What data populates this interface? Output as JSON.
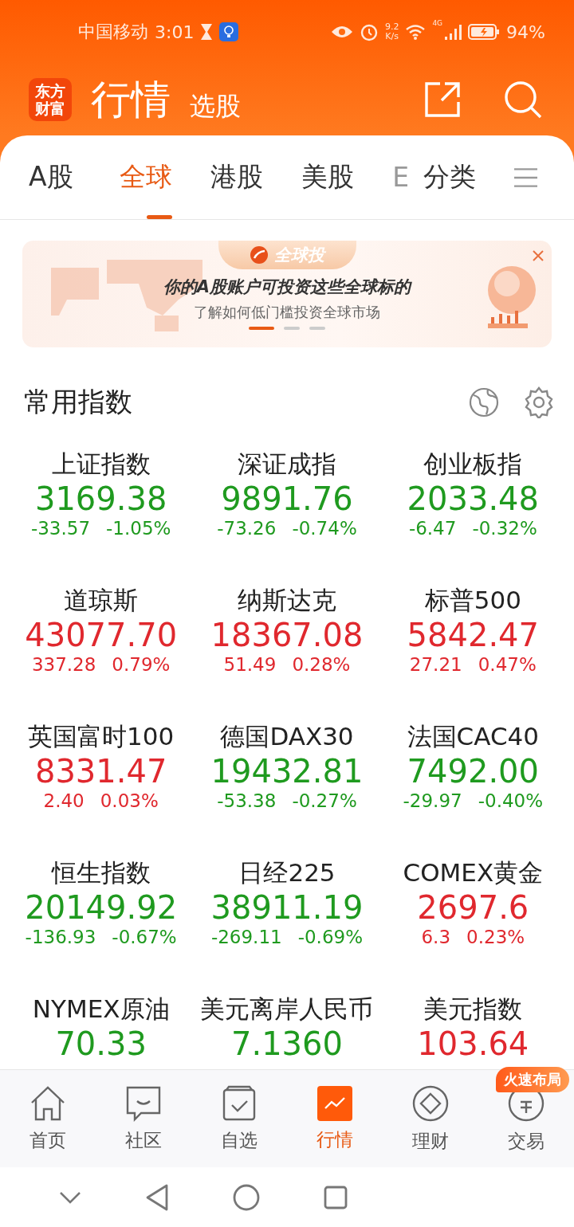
{
  "status_bar": {
    "carrier": "中国移动",
    "time": "3:01",
    "speed_value": "9.2",
    "speed_unit": "K/s",
    "network": "4G",
    "battery": "94%"
  },
  "header": {
    "logo": "东方财富",
    "title": "行情",
    "subtitle": "选股"
  },
  "tabs": [
    {
      "label": "A股",
      "selected": false
    },
    {
      "label": "全球",
      "selected": true
    },
    {
      "label": "港股",
      "selected": false
    },
    {
      "label": "美股",
      "selected": false
    },
    {
      "label": "E",
      "selected": false
    },
    {
      "label": "分类",
      "selected": false
    }
  ],
  "banner": {
    "ribbon": "全球投",
    "title": "你的A股账户可投资这些全球标的",
    "subtitle": "了解如何低门槛投资全球市场",
    "dots": [
      {
        "selected": true
      },
      {
        "selected": false
      },
      {
        "selected": false
      }
    ]
  },
  "section": {
    "title": "常用指数"
  },
  "indices": [
    {
      "name": "上证指数",
      "value": "3169.38",
      "change": "-33.57",
      "pct": "-1.05%",
      "color": "#1f9a1f"
    },
    {
      "name": "深证成指",
      "value": "9891.76",
      "change": "-73.26",
      "pct": "-0.74%",
      "color": "#1f9a1f"
    },
    {
      "name": "创业板指",
      "value": "2033.48",
      "change": "-6.47",
      "pct": "-0.32%",
      "color": "#1f9a1f"
    },
    {
      "name": "道琼斯",
      "value": "43077.70",
      "change": "337.28",
      "pct": "0.79%",
      "color": "#e0282e"
    },
    {
      "name": "纳斯达克",
      "value": "18367.08",
      "change": "51.49",
      "pct": "0.28%",
      "color": "#e0282e"
    },
    {
      "name": "标普500",
      "value": "5842.47",
      "change": "27.21",
      "pct": "0.47%",
      "color": "#e0282e"
    },
    {
      "name": "英国富时100",
      "value": "8331.47",
      "change": "2.40",
      "pct": "0.03%",
      "color": "#e0282e"
    },
    {
      "name": "德国DAX30",
      "value": "19432.81",
      "change": "-53.38",
      "pct": "-0.27%",
      "color": "#1f9a1f"
    },
    {
      "name": "法国CAC40",
      "value": "7492.00",
      "change": "-29.97",
      "pct": "-0.40%",
      "color": "#1f9a1f"
    },
    {
      "name": "恒生指数",
      "value": "20149.92",
      "change": "-136.93",
      "pct": "-0.67%",
      "color": "#1f9a1f"
    },
    {
      "name": "日经225",
      "value": "38911.19",
      "change": "-269.11",
      "pct": "-0.69%",
      "color": "#1f9a1f"
    },
    {
      "name": "COMEX黄金",
      "value": "2697.6",
      "change": "6.3",
      "pct": "0.23%",
      "color": "#e0282e"
    },
    {
      "name": "NYMEX原油",
      "value": "70.33",
      "color": "#1f9a1f"
    },
    {
      "name": "美元离岸人民币",
      "value": "7.1360",
      "color": "#1f9a1f"
    },
    {
      "name": "美元指数",
      "value": "103.64",
      "color": "#e0282e"
    }
  ],
  "bottom_nav": [
    {
      "label": "首页",
      "kind": "home",
      "selected": false
    },
    {
      "label": "社区",
      "kind": "chat",
      "selected": false
    },
    {
      "label": "自选",
      "kind": "check",
      "selected": false
    },
    {
      "label": "行情",
      "kind": "chart",
      "selected": true
    },
    {
      "label": "理财",
      "kind": "diamond",
      "selected": false
    },
    {
      "label": "交易",
      "kind": "yen",
      "selected": false
    }
  ],
  "promo_badge": "火速布局"
}
